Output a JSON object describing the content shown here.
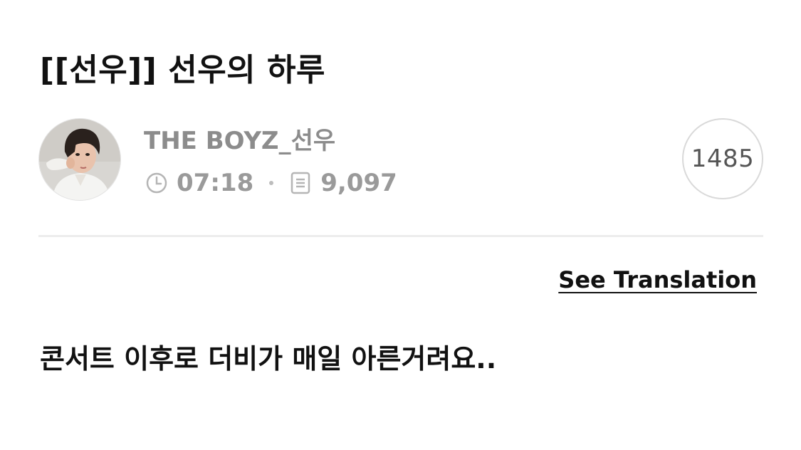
{
  "post": {
    "title": "[[선우]] 선우의 하루",
    "body": "콘서트 이후로 더비가 매일 아른거려요.."
  },
  "author": {
    "name": "THE BOYZ_선우",
    "time": "07:18",
    "views": "9,097"
  },
  "badge": {
    "count": "1485"
  },
  "actions": {
    "see_translation": "See Translation"
  },
  "icons": {
    "time": "clock-icon",
    "views": "document-icon"
  },
  "colors": {
    "meta_text": "#9a9a9a",
    "author_name": "#8c8c8c",
    "divider": "#ececec",
    "badge_border": "#d9d9d9"
  }
}
